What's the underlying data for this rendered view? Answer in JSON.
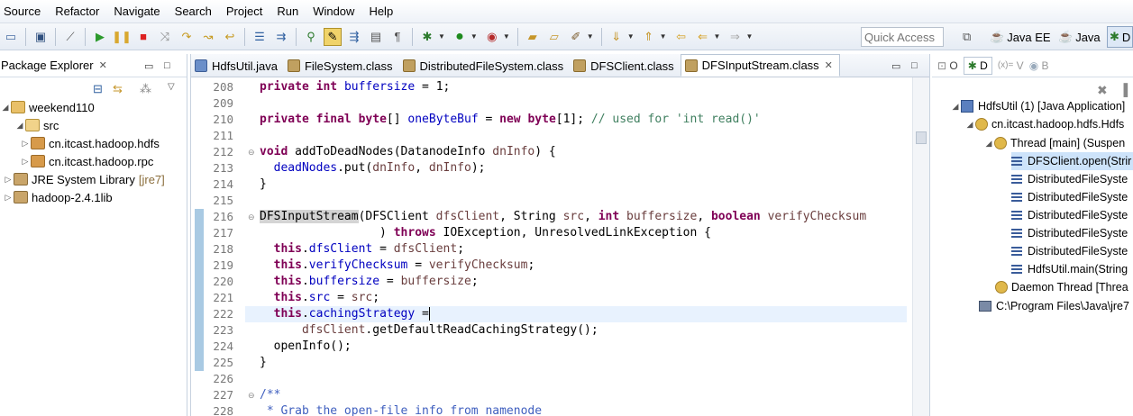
{
  "menu": [
    "Source",
    "Refactor",
    "Navigate",
    "Search",
    "Project",
    "Run",
    "Window",
    "Help"
  ],
  "toolbar": {
    "quick_access_placeholder": "Quick Access",
    "perspectives": [
      "Java EE",
      "Java",
      "D"
    ]
  },
  "package_explorer": {
    "title": "Package Explorer",
    "tree": [
      {
        "label": "weekend110",
        "depth": 0,
        "expanded": true,
        "icon": "project-icon"
      },
      {
        "label": "src",
        "depth": 1,
        "expanded": true,
        "icon": "source-folder-icon"
      },
      {
        "label": "cn.itcast.hadoop.hdfs",
        "depth": 2,
        "expanded": false,
        "icon": "package-icon"
      },
      {
        "label": "cn.itcast.hadoop.rpc",
        "depth": 2,
        "expanded": false,
        "icon": "package-icon"
      },
      {
        "label": "JRE System Library",
        "tag": "[jre7]",
        "depth": 1,
        "expanded": false,
        "icon": "library-icon"
      },
      {
        "label": "hadoop-2.4.1lib",
        "depth": 1,
        "expanded": false,
        "icon": "library-icon"
      }
    ]
  },
  "editor": {
    "tabs": [
      "HdfsUtil.java",
      "FileSystem.class",
      "DistributedFileSystem.class",
      "DFSClient.class",
      "DFSInputStream.class"
    ],
    "active_tab": "DFSInputStream.class",
    "lines": [
      {
        "n": "208",
        "fold": ""
      },
      {
        "n": "209",
        "fold": ""
      },
      {
        "n": "210",
        "fold": ""
      },
      {
        "n": "211",
        "fold": ""
      },
      {
        "n": "212",
        "fold": "⊖"
      },
      {
        "n": "213",
        "fold": ""
      },
      {
        "n": "214",
        "fold": ""
      },
      {
        "n": "215",
        "fold": ""
      },
      {
        "n": "216",
        "fold": "⊖"
      },
      {
        "n": "217",
        "fold": ""
      },
      {
        "n": "218",
        "fold": ""
      },
      {
        "n": "219",
        "fold": ""
      },
      {
        "n": "220",
        "fold": ""
      },
      {
        "n": "221",
        "fold": ""
      },
      {
        "n": "222",
        "fold": ""
      },
      {
        "n": "223",
        "fold": ""
      },
      {
        "n": "224",
        "fold": ""
      },
      {
        "n": "225",
        "fold": ""
      },
      {
        "n": "226",
        "fold": ""
      },
      {
        "n": "227",
        "fold": "⊖"
      },
      {
        "n": "228",
        "fold": ""
      }
    ],
    "code": {
      "l208": [
        "private",
        " ",
        "int",
        " ",
        "buffersize",
        " = 1;"
      ],
      "l210": [
        "private",
        " ",
        "final",
        " ",
        "byte",
        "[] ",
        "oneByteBuf",
        " = ",
        "new",
        " ",
        "byte",
        "[1]; ",
        "// used for 'int read()'"
      ],
      "l212": [
        "void",
        " addToDeadNodes(DatanodeInfo ",
        "dnInfo",
        ") {"
      ],
      "l213": [
        "  ",
        "deadNodes",
        ".put(",
        "dnInfo",
        ", ",
        "dnInfo",
        ");"
      ],
      "l214": "}",
      "l216": [
        "DFSInputStream",
        "(DFSClient ",
        "dfsClient",
        ", String ",
        "src",
        ", ",
        "int",
        " ",
        "buffersize",
        ", ",
        "boolean",
        " ",
        "verifyChecksum"
      ],
      "l217": [
        "                 ) ",
        "throws",
        " IOException, UnresolvedLinkException {"
      ],
      "l218": [
        "  ",
        "this",
        ".",
        "dfsClient",
        " = ",
        "dfsClient",
        ";"
      ],
      "l219": [
        "  ",
        "this",
        ".",
        "verifyChecksum",
        " = ",
        "verifyChecksum",
        ";"
      ],
      "l220": [
        "  ",
        "this",
        ".",
        "buffersize",
        " = ",
        "buffersize",
        ";"
      ],
      "l221": [
        "  ",
        "this",
        ".",
        "src",
        " = ",
        "src",
        ";"
      ],
      "l222": [
        "  ",
        "this",
        ".",
        "cachingStrategy",
        " ="
      ],
      "l223": [
        "      ",
        "dfsClient",
        ".getDefaultReadCachingStrategy();"
      ],
      "l224": "  openInfo();",
      "l225": "}",
      "l227": "/**",
      "l228": " * Grab the open-file info from namenode"
    }
  },
  "right_panel": {
    "tabs": [
      "O",
      "D",
      "V",
      "B"
    ],
    "debug_tree": [
      {
        "label": "HdfsUtil (1) [Java Application]",
        "depth": 0,
        "icon": "java-app-icon"
      },
      {
        "label": "cn.itcast.hadoop.hdfs.Hdfs",
        "depth": 1,
        "icon": "java-vm-icon"
      },
      {
        "label": "Thread [main] (Suspen",
        "depth": 2,
        "icon": "thread-icon"
      },
      {
        "label": "DFSClient.open(Strir",
        "depth": 3,
        "icon": "stack-frame-icon",
        "selected": true
      },
      {
        "label": "DistributedFileSyste",
        "depth": 3,
        "icon": "stack-frame-icon"
      },
      {
        "label": "DistributedFileSyste",
        "depth": 3,
        "icon": "stack-frame-icon"
      },
      {
        "label": "DistributedFileSyste",
        "depth": 3,
        "icon": "stack-frame-icon"
      },
      {
        "label": "DistributedFileSyste",
        "depth": 3,
        "icon": "stack-frame-icon"
      },
      {
        "label": "DistributedFileSyste",
        "depth": 3,
        "icon": "stack-frame-icon"
      },
      {
        "label": "HdfsUtil.main(String",
        "depth": 3,
        "icon": "stack-frame-icon"
      },
      {
        "label": "Daemon Thread [Threa",
        "depth": 2,
        "icon": "thread-icon"
      },
      {
        "label": "C:\\Program Files\\Java\\jre7",
        "depth": 1,
        "icon": "process-icon"
      }
    ]
  }
}
